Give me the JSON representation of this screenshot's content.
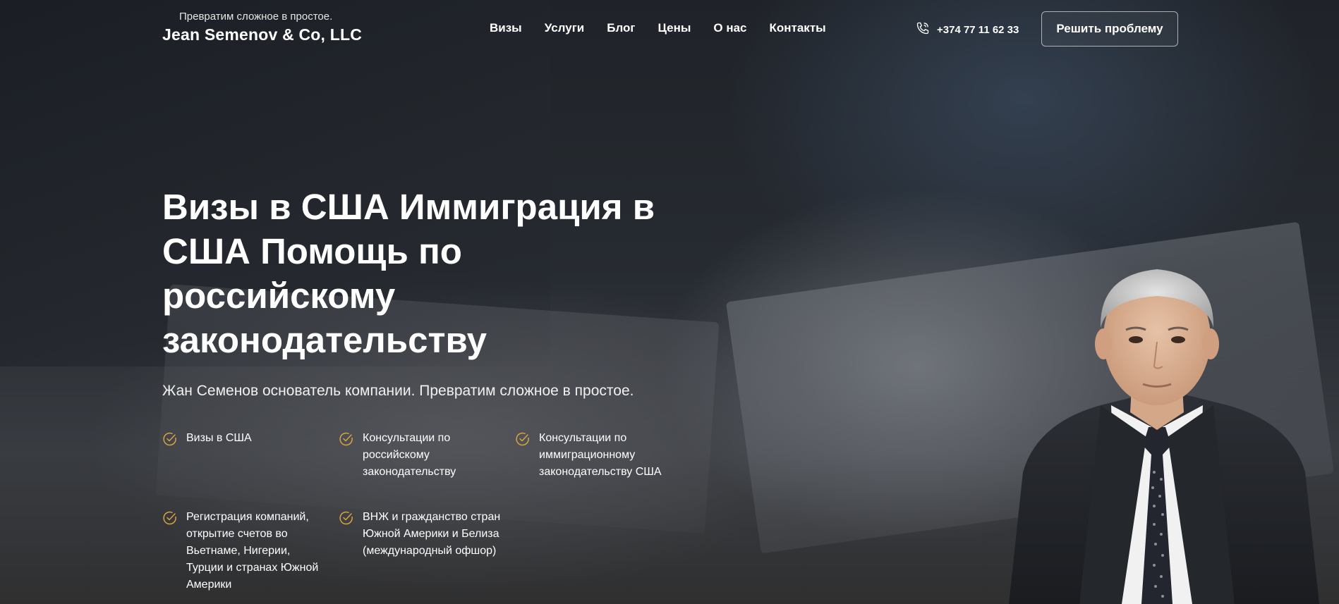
{
  "header": {
    "tagline": "Превратим сложное в простое.",
    "brand_name": "Jean Semenov & Co, LLC",
    "nav": [
      "Визы",
      "Услуги",
      "Блог",
      "Цены",
      "О нас",
      "Контакты"
    ],
    "phone": "+374 77 11 62 33",
    "cta_label": "Решить проблему"
  },
  "hero": {
    "title": "Визы в США Иммиграция в США Помощь по российскому законодательству",
    "subtitle": "Жан Семенов основатель компании. Превратим сложное в простое.",
    "features": [
      "Визы в США",
      "Консультации по российскому законодательству",
      "Консультации по иммиграционному законодательству США",
      "Регистрация компаний, открытие счетов во Вьетнаме, Нигерии, Турции и странах Южной Америки",
      "ВНЖ и гражданство стран Южной Америки и Белиза (международный офшор)"
    ]
  },
  "colors": {
    "accent_check": "#d9a441",
    "text": "#ffffff",
    "overlay": "#1f242b"
  },
  "icons": {
    "phone": "phone-icon",
    "feature": "check-circle-icon"
  }
}
